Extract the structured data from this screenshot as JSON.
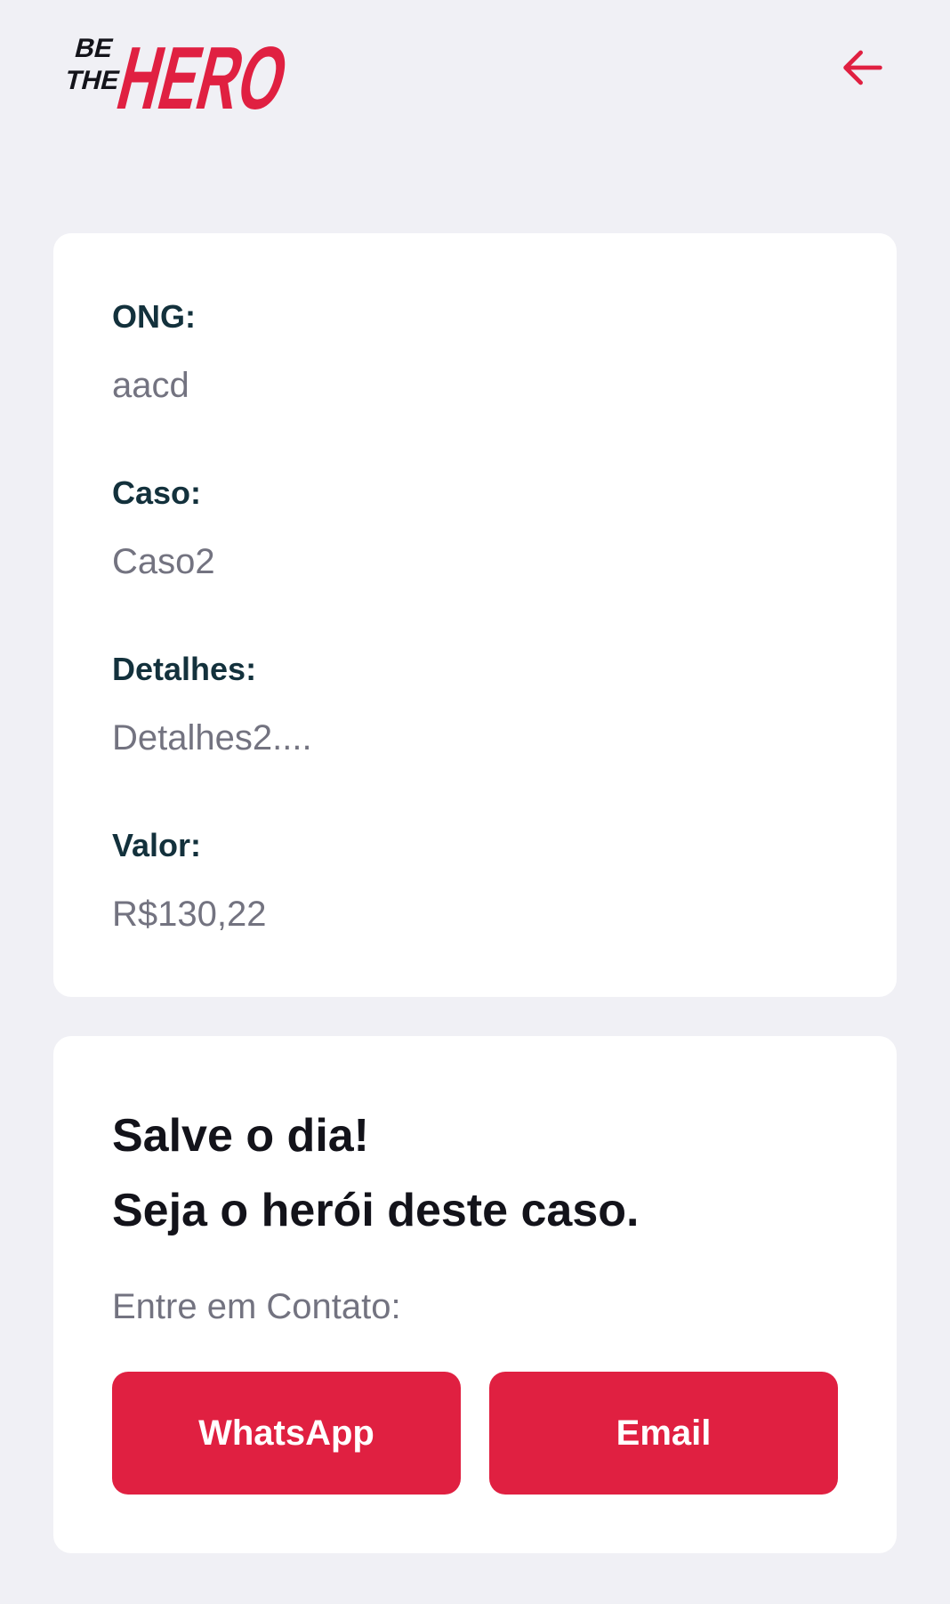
{
  "header": {
    "logo": {
      "line1": "BE",
      "line2": "THE",
      "word": "HERO"
    },
    "back_icon": "arrow-left-icon"
  },
  "incident": {
    "fields": [
      {
        "label": "ONG:",
        "value": "aacd"
      },
      {
        "label": "Caso:",
        "value": "Caso2"
      },
      {
        "label": "Detalhes:",
        "value": "Detalhes2...."
      },
      {
        "label": "Valor:",
        "value": "R$130,22"
      }
    ]
  },
  "contact": {
    "title_line1": "Salve o dia!",
    "title_line2": "Seja o herói deste caso.",
    "description": "Entre em Contato:",
    "whatsapp_label": "WhatsApp",
    "email_label": "Email"
  },
  "colors": {
    "accent": "#e02041",
    "background": "#f0f0f5",
    "label": "#13313c",
    "value": "#737380",
    "card": "#ffffff"
  }
}
